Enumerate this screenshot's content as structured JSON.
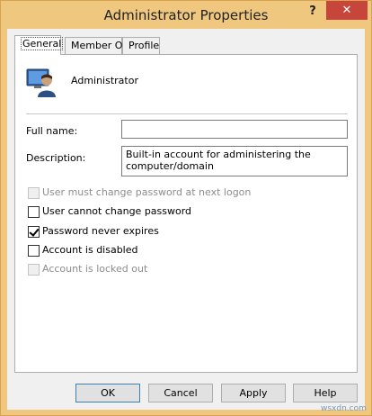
{
  "window": {
    "title": "Administrator Properties",
    "help_label": "?",
    "close_label": "✕"
  },
  "tabs": [
    {
      "label": "General",
      "active": true
    },
    {
      "label": "Member Of",
      "active": false
    },
    {
      "label": "Profile",
      "active": false
    }
  ],
  "general": {
    "user_icon": "user-account-icon",
    "user_name": "Administrator",
    "full_name_label": "Full name:",
    "full_name_value": "",
    "description_label": "Description:",
    "description_value": "Built-in account for administering the computer/domain",
    "checkboxes": [
      {
        "label": "User must change password at next logon",
        "checked": false,
        "enabled": false
      },
      {
        "label": "User cannot change password",
        "checked": false,
        "enabled": true
      },
      {
        "label": "Password never expires",
        "checked": true,
        "enabled": true
      },
      {
        "label": "Account is disabled",
        "checked": false,
        "enabled": true
      },
      {
        "label": "Account is locked out",
        "checked": false,
        "enabled": false
      }
    ]
  },
  "buttons": {
    "ok": "OK",
    "cancel": "Cancel",
    "apply": "Apply",
    "help": "Help"
  },
  "watermark": "wsxdn.com",
  "colors": {
    "titlebar": "#f0c77e",
    "close": "#c7463b"
  }
}
